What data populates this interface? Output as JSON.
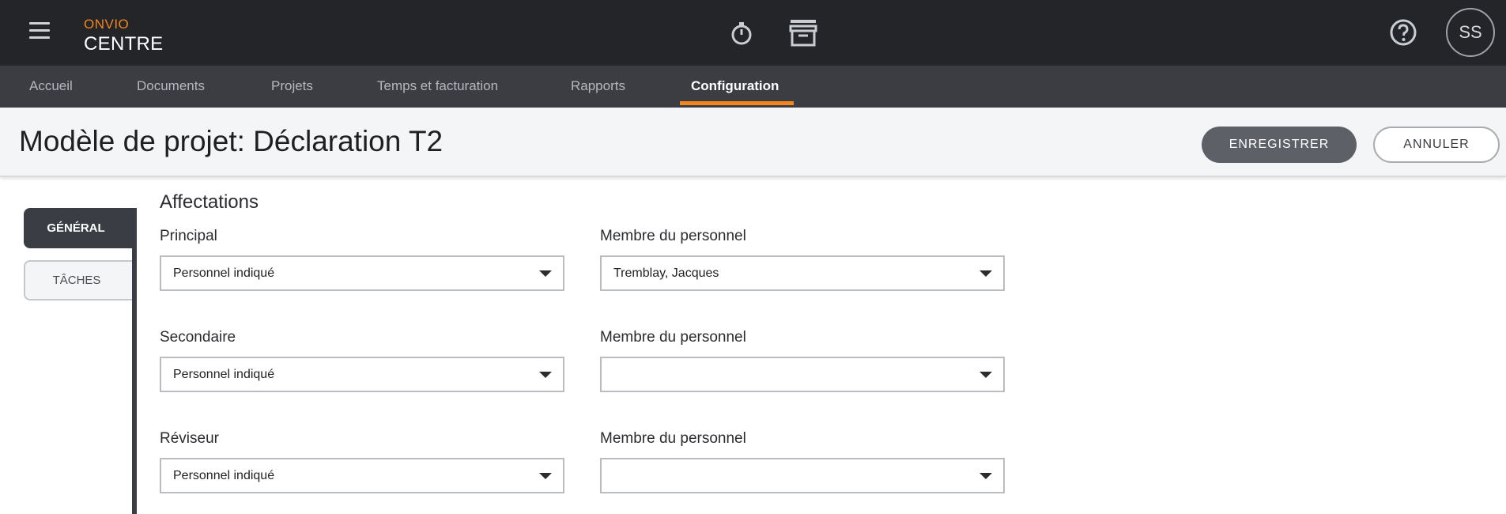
{
  "app": {
    "brand_top": "ONVIO",
    "brand_bottom": "CENTRE",
    "avatar_initials": "SS",
    "accent_color": "#f3861f"
  },
  "topbar": {
    "icons": [
      "menu-icon",
      "timer-icon",
      "archive-icon",
      "help-icon"
    ]
  },
  "nav": {
    "items": [
      {
        "label": "Accueil"
      },
      {
        "label": "Documents"
      },
      {
        "label": "Projets"
      },
      {
        "label": "Temps et facturation"
      },
      {
        "label": "Rapports"
      },
      {
        "label": "Configuration",
        "active": true
      }
    ]
  },
  "header": {
    "title": "Modèle de projet: Déclaration T2",
    "save_label": "ENREGISTRER",
    "cancel_label": "ANNULER"
  },
  "tabs": {
    "general": "GÉNÉRAL",
    "taches": "TÂCHES",
    "active": "general"
  },
  "form": {
    "section_title": "Affectations",
    "rows": [
      {
        "role_label": "Principal",
        "role_value": "Personnel indiqué",
        "staff_label": "Membre du personnel",
        "staff_value": "Tremblay, Jacques"
      },
      {
        "role_label": "Secondaire",
        "role_value": "Personnel indiqué",
        "staff_label": "Membre du personnel",
        "staff_value": ""
      },
      {
        "role_label": "Réviseur",
        "role_value": "Personnel indiqué",
        "staff_label": "Membre du personnel",
        "staff_value": ""
      }
    ]
  }
}
